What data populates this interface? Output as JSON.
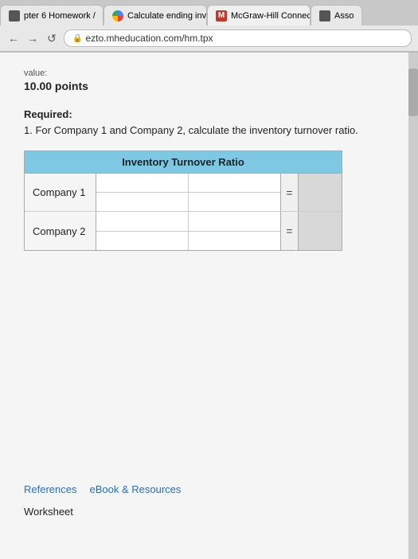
{
  "browser": {
    "tabs": [
      {
        "id": "tab1",
        "label": "pter 6 Homework /",
        "icon_type": "doc",
        "active": false
      },
      {
        "id": "tab2",
        "label": "Calculate ending inver",
        "icon_type": "google",
        "active": false
      },
      {
        "id": "tab3",
        "label": "McGraw-Hill Connect |",
        "icon_type": "mcgraw",
        "active": true
      },
      {
        "id": "tab4",
        "label": "Asso",
        "icon_type": "doc",
        "active": false
      }
    ],
    "url": "ezto.mheducation.com/hm.tpx",
    "url_prefix": "⊙"
  },
  "page": {
    "value_label": "value:",
    "points": "10.00 points",
    "required_title": "Required:",
    "required_text": "1. For Company 1 and Company 2, calculate the inventory turnover ratio.",
    "table": {
      "header": "Inventory Turnover Ratio",
      "rows": [
        {
          "label": "Company 1",
          "equals": "="
        },
        {
          "label": "Company 2",
          "equals": "="
        }
      ]
    },
    "footer": {
      "references_label": "References",
      "ebook_label": "eBook & Resources",
      "worksheet_label": "Worksheet"
    }
  }
}
